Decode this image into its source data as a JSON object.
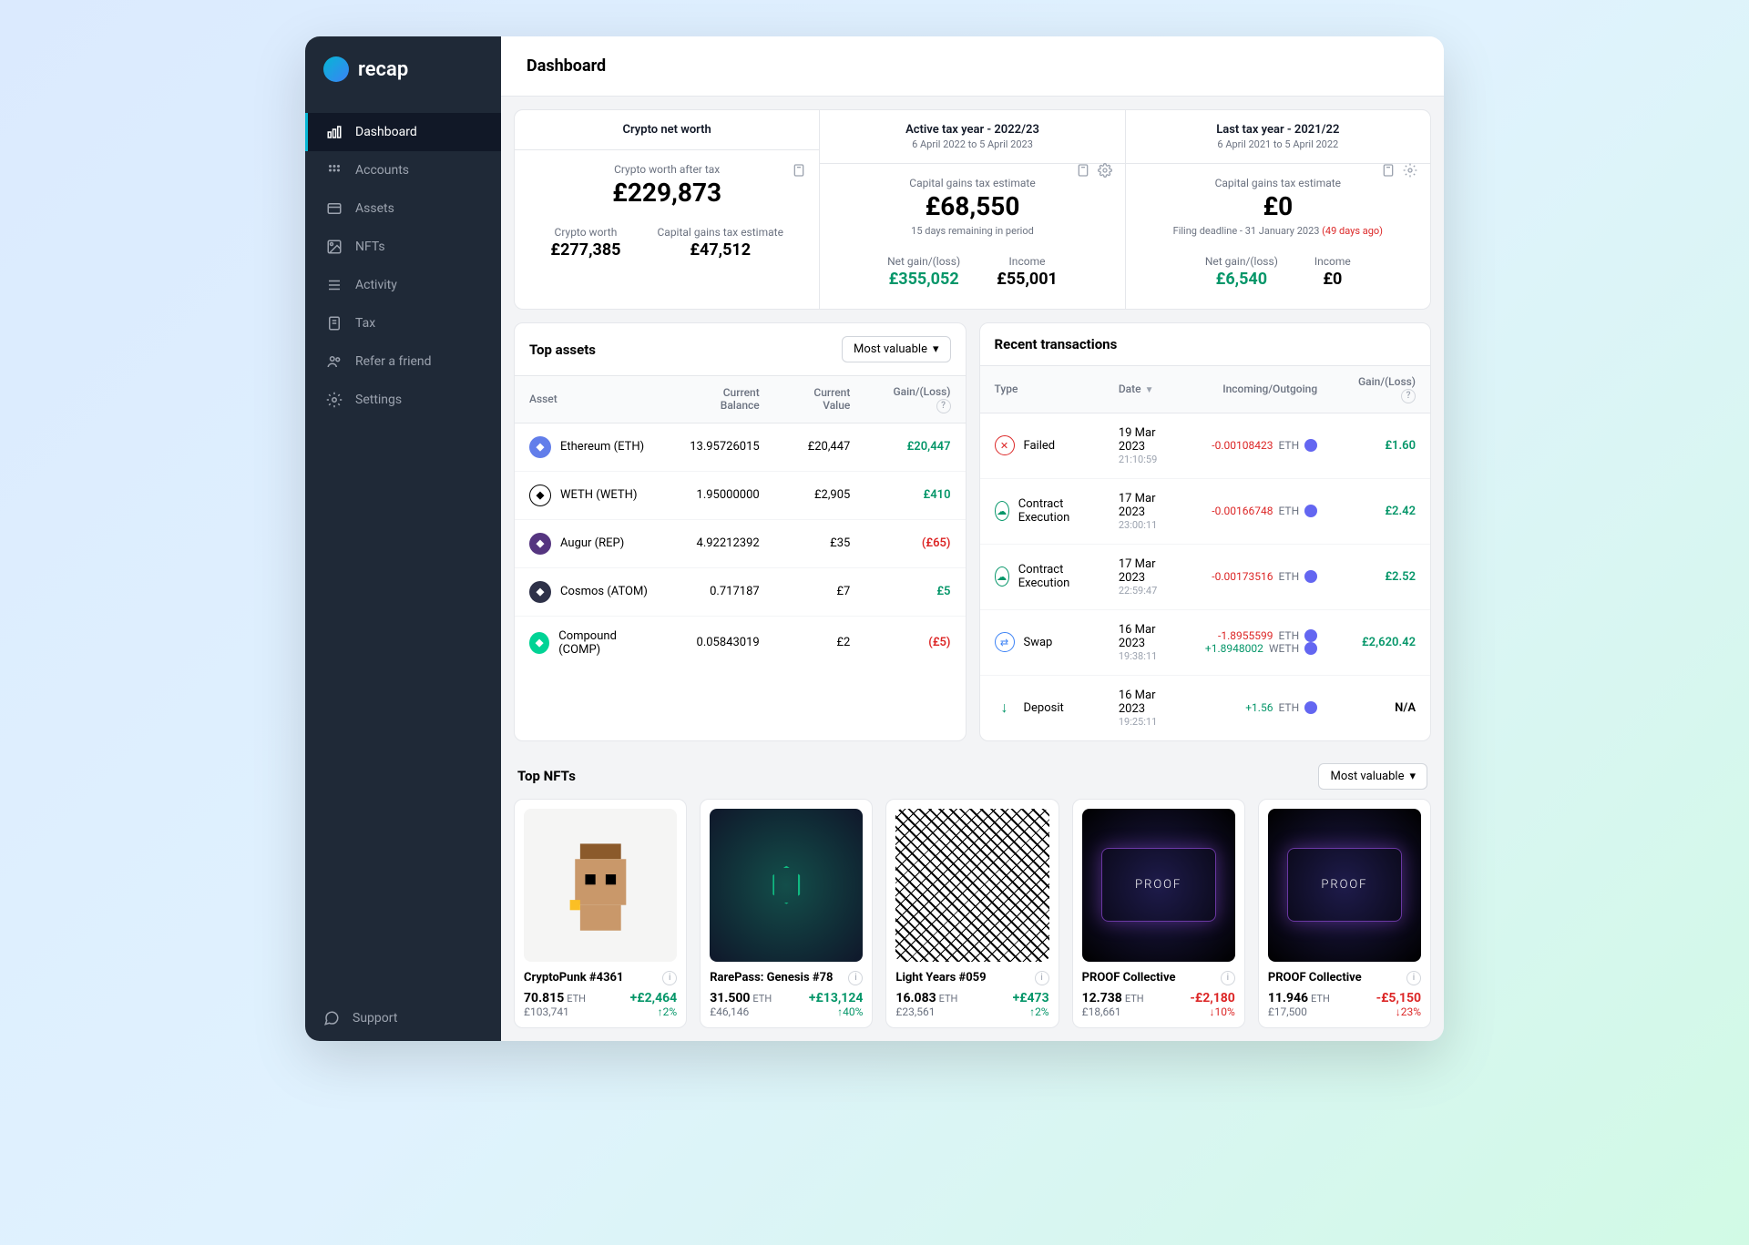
{
  "brand": "recap",
  "header": {
    "title": "Dashboard"
  },
  "sidebar": {
    "items": [
      {
        "label": "Dashboard",
        "active": true
      },
      {
        "label": "Accounts"
      },
      {
        "label": "Assets"
      },
      {
        "label": "NFTs"
      },
      {
        "label": "Activity"
      },
      {
        "label": "Tax"
      },
      {
        "label": "Refer a friend"
      },
      {
        "label": "Settings"
      }
    ],
    "support": "Support"
  },
  "summary": {
    "networth": {
      "title": "Crypto net worth",
      "after_tax_label": "Crypto worth after tax",
      "after_tax_value": "£229,873",
      "worth_label": "Crypto worth",
      "worth_value": "£277,385",
      "cgt_label": "Capital gains tax estimate",
      "cgt_value": "£47,512"
    },
    "active_year": {
      "title": "Active tax year - 2022/23",
      "range": "6 April 2022 to 5 April 2023",
      "cgt_label": "Capital gains tax estimate",
      "cgt_value": "£68,550",
      "days_remaining": "15 days remaining in period",
      "netgain_label": "Net gain/(loss)",
      "netgain_value": "£355,052",
      "income_label": "Income",
      "income_value": "£55,001"
    },
    "last_year": {
      "title": "Last tax year - 2021/22",
      "range": "6 April 2021 to 5 April 2022",
      "cgt_label": "Capital gains tax estimate",
      "cgt_value": "£0",
      "deadline_prefix": "Filing deadline - 31 January 2023 ",
      "deadline_ago": "(49 days ago)",
      "netgain_label": "Net gain/(loss)",
      "netgain_value": "£6,540",
      "income_label": "Income",
      "income_value": "£0"
    }
  },
  "top_assets": {
    "title": "Top assets",
    "sort_label": "Most valuable",
    "columns": {
      "asset": "Asset",
      "balance": "Current Balance",
      "value": "Current Value",
      "gain": "Gain/(Loss)"
    },
    "rows": [
      {
        "name": "Ethereum (ETH)",
        "balance": "13.95726015",
        "value": "£20,447",
        "gain": "£20,447",
        "gain_class": "green",
        "color": "#627eea"
      },
      {
        "name": "WETH (WETH)",
        "balance": "1.95000000",
        "value": "£2,905",
        "gain": "£410",
        "gain_class": "green",
        "color": "#fff",
        "border": "#000"
      },
      {
        "name": "Augur (REP)",
        "balance": "4.92212392",
        "value": "£35",
        "gain": "(£65)",
        "gain_class": "red",
        "color": "#553580"
      },
      {
        "name": "Cosmos (ATOM)",
        "balance": "0.717187",
        "value": "£7",
        "gain": "£5",
        "gain_class": "green",
        "color": "#2e3148"
      },
      {
        "name": "Compound (COMP)",
        "balance": "0.05843019",
        "value": "£2",
        "gain": "(£5)",
        "gain_class": "red",
        "color": "#00d395"
      }
    ]
  },
  "recent_tx": {
    "title": "Recent transactions",
    "columns": {
      "type": "Type",
      "date": "Date",
      "io": "Incoming/Outgoing",
      "gain": "Gain/(Loss)"
    },
    "rows": [
      {
        "type": "Failed",
        "icon_color": "#dc2626",
        "date": "19 Mar 2023",
        "time": "21:10:59",
        "io": [
          {
            "amount": "-0.00108423",
            "sym": "ETH",
            "cls": "red"
          }
        ],
        "gain": "£1.60",
        "gain_class": "green"
      },
      {
        "type": "Contract Execution",
        "icon_color": "#059669",
        "date": "17 Mar 2023",
        "time": "23:00:11",
        "io": [
          {
            "amount": "-0.00166748",
            "sym": "ETH",
            "cls": "red"
          }
        ],
        "gain": "£2.42",
        "gain_class": "green"
      },
      {
        "type": "Contract Execution",
        "icon_color": "#059669",
        "date": "17 Mar 2023",
        "time": "22:59:47",
        "io": [
          {
            "amount": "-0.00173516",
            "sym": "ETH",
            "cls": "red"
          }
        ],
        "gain": "£2.52",
        "gain_class": "green"
      },
      {
        "type": "Swap",
        "icon_color": "#3b82f6",
        "date": "16 Mar 2023",
        "time": "19:38:11",
        "io": [
          {
            "amount": "-1.8955599",
            "sym": "ETH",
            "cls": "red"
          },
          {
            "amount": "+1.8948002",
            "sym": "WETH",
            "cls": "green"
          }
        ],
        "gain": "£2,620.42",
        "gain_class": "green"
      },
      {
        "type": "Deposit",
        "icon_color": "#059669",
        "date": "16 Mar 2023",
        "time": "19:25:11",
        "io": [
          {
            "amount": "+1.56",
            "sym": "ETH",
            "cls": "green"
          }
        ],
        "gain": "N/A",
        "gain_class": ""
      }
    ]
  },
  "top_nfts": {
    "title": "Top NFTs",
    "sort_label": "Most valuable",
    "cards": [
      {
        "name": "CryptoPunk #4361",
        "amount": "70.815",
        "sym": "ETH",
        "fiat": "£103,741",
        "gain": "+£2,464",
        "pct": "↑2%",
        "gain_class": "green",
        "img": "cryptopunk"
      },
      {
        "name": "RarePass: Genesis #78",
        "amount": "31.500",
        "sym": "ETH",
        "fiat": "£46,146",
        "gain": "+£13,124",
        "pct": "↑40%",
        "gain_class": "green",
        "img": "rarepass"
      },
      {
        "name": "Light Years #059",
        "amount": "16.083",
        "sym": "ETH",
        "fiat": "£23,561",
        "gain": "+£473",
        "pct": "↑2%",
        "gain_class": "green",
        "img": "lightyears"
      },
      {
        "name": "PROOF Collective",
        "amount": "12.738",
        "sym": "ETH",
        "fiat": "£18,661",
        "gain": "-£2,180",
        "pct": "↓10%",
        "gain_class": "red",
        "img": "proof"
      },
      {
        "name": "PROOF Collective",
        "amount": "11.946",
        "sym": "ETH",
        "fiat": "£17,500",
        "gain": "-£5,150",
        "pct": "↓23%",
        "gain_class": "red",
        "img": "proof"
      }
    ]
  }
}
